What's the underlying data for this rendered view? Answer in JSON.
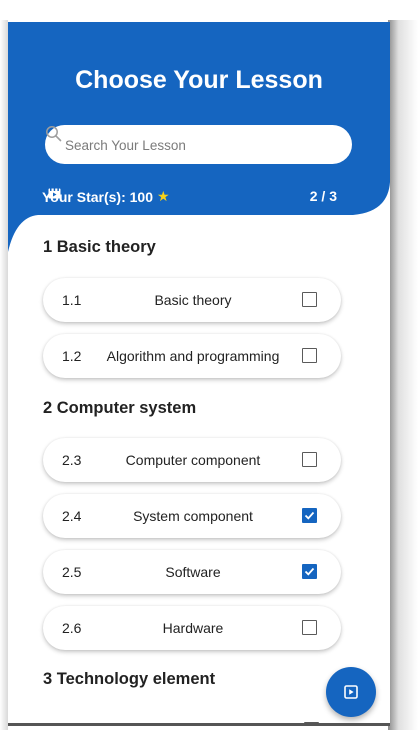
{
  "header": {
    "title": "Choose Your Lesson",
    "search_placeholder": "Search Your Lesson",
    "stars_label": "Your Star(s): 100",
    "star_icon": "★",
    "page_indicator": "2 / 3",
    "color_primary": "#1565c0"
  },
  "sections": [
    {
      "title": "1 Basic theory",
      "lessons": [
        {
          "num": "1.1",
          "name": "Basic theory",
          "checked": false
        },
        {
          "num": "1.2",
          "name": "Algorithm and programming",
          "checked": false
        }
      ]
    },
    {
      "title": "2 Computer system",
      "lessons": [
        {
          "num": "2.3",
          "name": "Computer component",
          "checked": false
        },
        {
          "num": "2.4",
          "name": "System component",
          "checked": true
        },
        {
          "num": "2.5",
          "name": "Software",
          "checked": true
        },
        {
          "num": "2.6",
          "name": "Hardware",
          "checked": false
        }
      ]
    },
    {
      "title": "3 Technology element",
      "lessons": []
    }
  ],
  "fab": {
    "icon": "play-box-icon"
  }
}
